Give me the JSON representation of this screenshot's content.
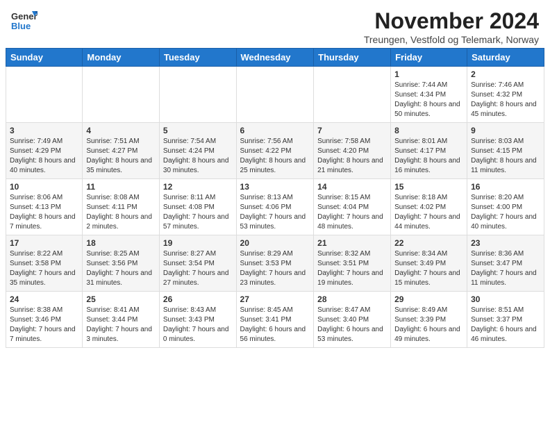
{
  "header": {
    "logo": {
      "line1": "General",
      "line2": "Blue"
    },
    "title": "November 2024",
    "location": "Treungen, Vestfold og Telemark, Norway"
  },
  "weekdays": [
    "Sunday",
    "Monday",
    "Tuesday",
    "Wednesday",
    "Thursday",
    "Friday",
    "Saturday"
  ],
  "weeks": [
    [
      {
        "day": "",
        "info": ""
      },
      {
        "day": "",
        "info": ""
      },
      {
        "day": "",
        "info": ""
      },
      {
        "day": "",
        "info": ""
      },
      {
        "day": "",
        "info": ""
      },
      {
        "day": "1",
        "info": "Sunrise: 7:44 AM\nSunset: 4:34 PM\nDaylight: 8 hours and 50 minutes."
      },
      {
        "day": "2",
        "info": "Sunrise: 7:46 AM\nSunset: 4:32 PM\nDaylight: 8 hours and 45 minutes."
      }
    ],
    [
      {
        "day": "3",
        "info": "Sunrise: 7:49 AM\nSunset: 4:29 PM\nDaylight: 8 hours and 40 minutes."
      },
      {
        "day": "4",
        "info": "Sunrise: 7:51 AM\nSunset: 4:27 PM\nDaylight: 8 hours and 35 minutes."
      },
      {
        "day": "5",
        "info": "Sunrise: 7:54 AM\nSunset: 4:24 PM\nDaylight: 8 hours and 30 minutes."
      },
      {
        "day": "6",
        "info": "Sunrise: 7:56 AM\nSunset: 4:22 PM\nDaylight: 8 hours and 25 minutes."
      },
      {
        "day": "7",
        "info": "Sunrise: 7:58 AM\nSunset: 4:20 PM\nDaylight: 8 hours and 21 minutes."
      },
      {
        "day": "8",
        "info": "Sunrise: 8:01 AM\nSunset: 4:17 PM\nDaylight: 8 hours and 16 minutes."
      },
      {
        "day": "9",
        "info": "Sunrise: 8:03 AM\nSunset: 4:15 PM\nDaylight: 8 hours and 11 minutes."
      }
    ],
    [
      {
        "day": "10",
        "info": "Sunrise: 8:06 AM\nSunset: 4:13 PM\nDaylight: 8 hours and 7 minutes."
      },
      {
        "day": "11",
        "info": "Sunrise: 8:08 AM\nSunset: 4:11 PM\nDaylight: 8 hours and 2 minutes."
      },
      {
        "day": "12",
        "info": "Sunrise: 8:11 AM\nSunset: 4:08 PM\nDaylight: 7 hours and 57 minutes."
      },
      {
        "day": "13",
        "info": "Sunrise: 8:13 AM\nSunset: 4:06 PM\nDaylight: 7 hours and 53 minutes."
      },
      {
        "day": "14",
        "info": "Sunrise: 8:15 AM\nSunset: 4:04 PM\nDaylight: 7 hours and 48 minutes."
      },
      {
        "day": "15",
        "info": "Sunrise: 8:18 AM\nSunset: 4:02 PM\nDaylight: 7 hours and 44 minutes."
      },
      {
        "day": "16",
        "info": "Sunrise: 8:20 AM\nSunset: 4:00 PM\nDaylight: 7 hours and 40 minutes."
      }
    ],
    [
      {
        "day": "17",
        "info": "Sunrise: 8:22 AM\nSunset: 3:58 PM\nDaylight: 7 hours and 35 minutes."
      },
      {
        "day": "18",
        "info": "Sunrise: 8:25 AM\nSunset: 3:56 PM\nDaylight: 7 hours and 31 minutes."
      },
      {
        "day": "19",
        "info": "Sunrise: 8:27 AM\nSunset: 3:54 PM\nDaylight: 7 hours and 27 minutes."
      },
      {
        "day": "20",
        "info": "Sunrise: 8:29 AM\nSunset: 3:53 PM\nDaylight: 7 hours and 23 minutes."
      },
      {
        "day": "21",
        "info": "Sunrise: 8:32 AM\nSunset: 3:51 PM\nDaylight: 7 hours and 19 minutes."
      },
      {
        "day": "22",
        "info": "Sunrise: 8:34 AM\nSunset: 3:49 PM\nDaylight: 7 hours and 15 minutes."
      },
      {
        "day": "23",
        "info": "Sunrise: 8:36 AM\nSunset: 3:47 PM\nDaylight: 7 hours and 11 minutes."
      }
    ],
    [
      {
        "day": "24",
        "info": "Sunrise: 8:38 AM\nSunset: 3:46 PM\nDaylight: 7 hours and 7 minutes."
      },
      {
        "day": "25",
        "info": "Sunrise: 8:41 AM\nSunset: 3:44 PM\nDaylight: 7 hours and 3 minutes."
      },
      {
        "day": "26",
        "info": "Sunrise: 8:43 AM\nSunset: 3:43 PM\nDaylight: 7 hours and 0 minutes."
      },
      {
        "day": "27",
        "info": "Sunrise: 8:45 AM\nSunset: 3:41 PM\nDaylight: 6 hours and 56 minutes."
      },
      {
        "day": "28",
        "info": "Sunrise: 8:47 AM\nSunset: 3:40 PM\nDaylight: 6 hours and 53 minutes."
      },
      {
        "day": "29",
        "info": "Sunrise: 8:49 AM\nSunset: 3:39 PM\nDaylight: 6 hours and 49 minutes."
      },
      {
        "day": "30",
        "info": "Sunrise: 8:51 AM\nSunset: 3:37 PM\nDaylight: 6 hours and 46 minutes."
      }
    ]
  ]
}
